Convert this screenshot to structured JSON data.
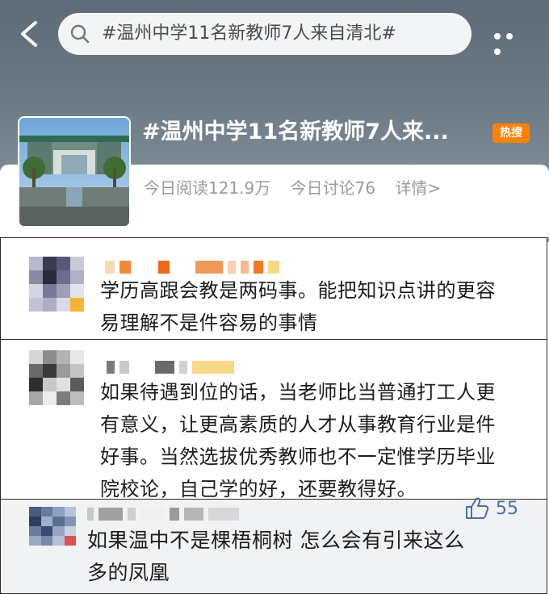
{
  "search": {
    "query": "#温州中学11名新教师7人来自清北#"
  },
  "topic": {
    "title": "#温州中学11名新教师7人来...",
    "badge": "热搜",
    "stats": {
      "reads": "今日阅读121.9万",
      "discussions": "今日讨论76",
      "details": "详情>"
    }
  },
  "comments": [
    {
      "lines": [
        "学历高跟会教是两码事。能把知识点讲的更容",
        "易理解不是件容易的事情"
      ]
    },
    {
      "lines": [
        "如果待遇到位的话，当老师比当普通打工人更",
        "有意义，让更高素质的人才从事教育行业是件",
        "好事。当然选拔优秀教师也不一定惟学历毕业",
        "院校论，自己学的好，还要教得好。"
      ]
    },
    {
      "lines": [
        "如果温中不是棵梧桐树 怎么会有引来这么",
        "多的凤凰"
      ],
      "likes": "55"
    }
  ],
  "colors": {
    "hot": "#ff8200",
    "like": "#4a6fa5"
  }
}
